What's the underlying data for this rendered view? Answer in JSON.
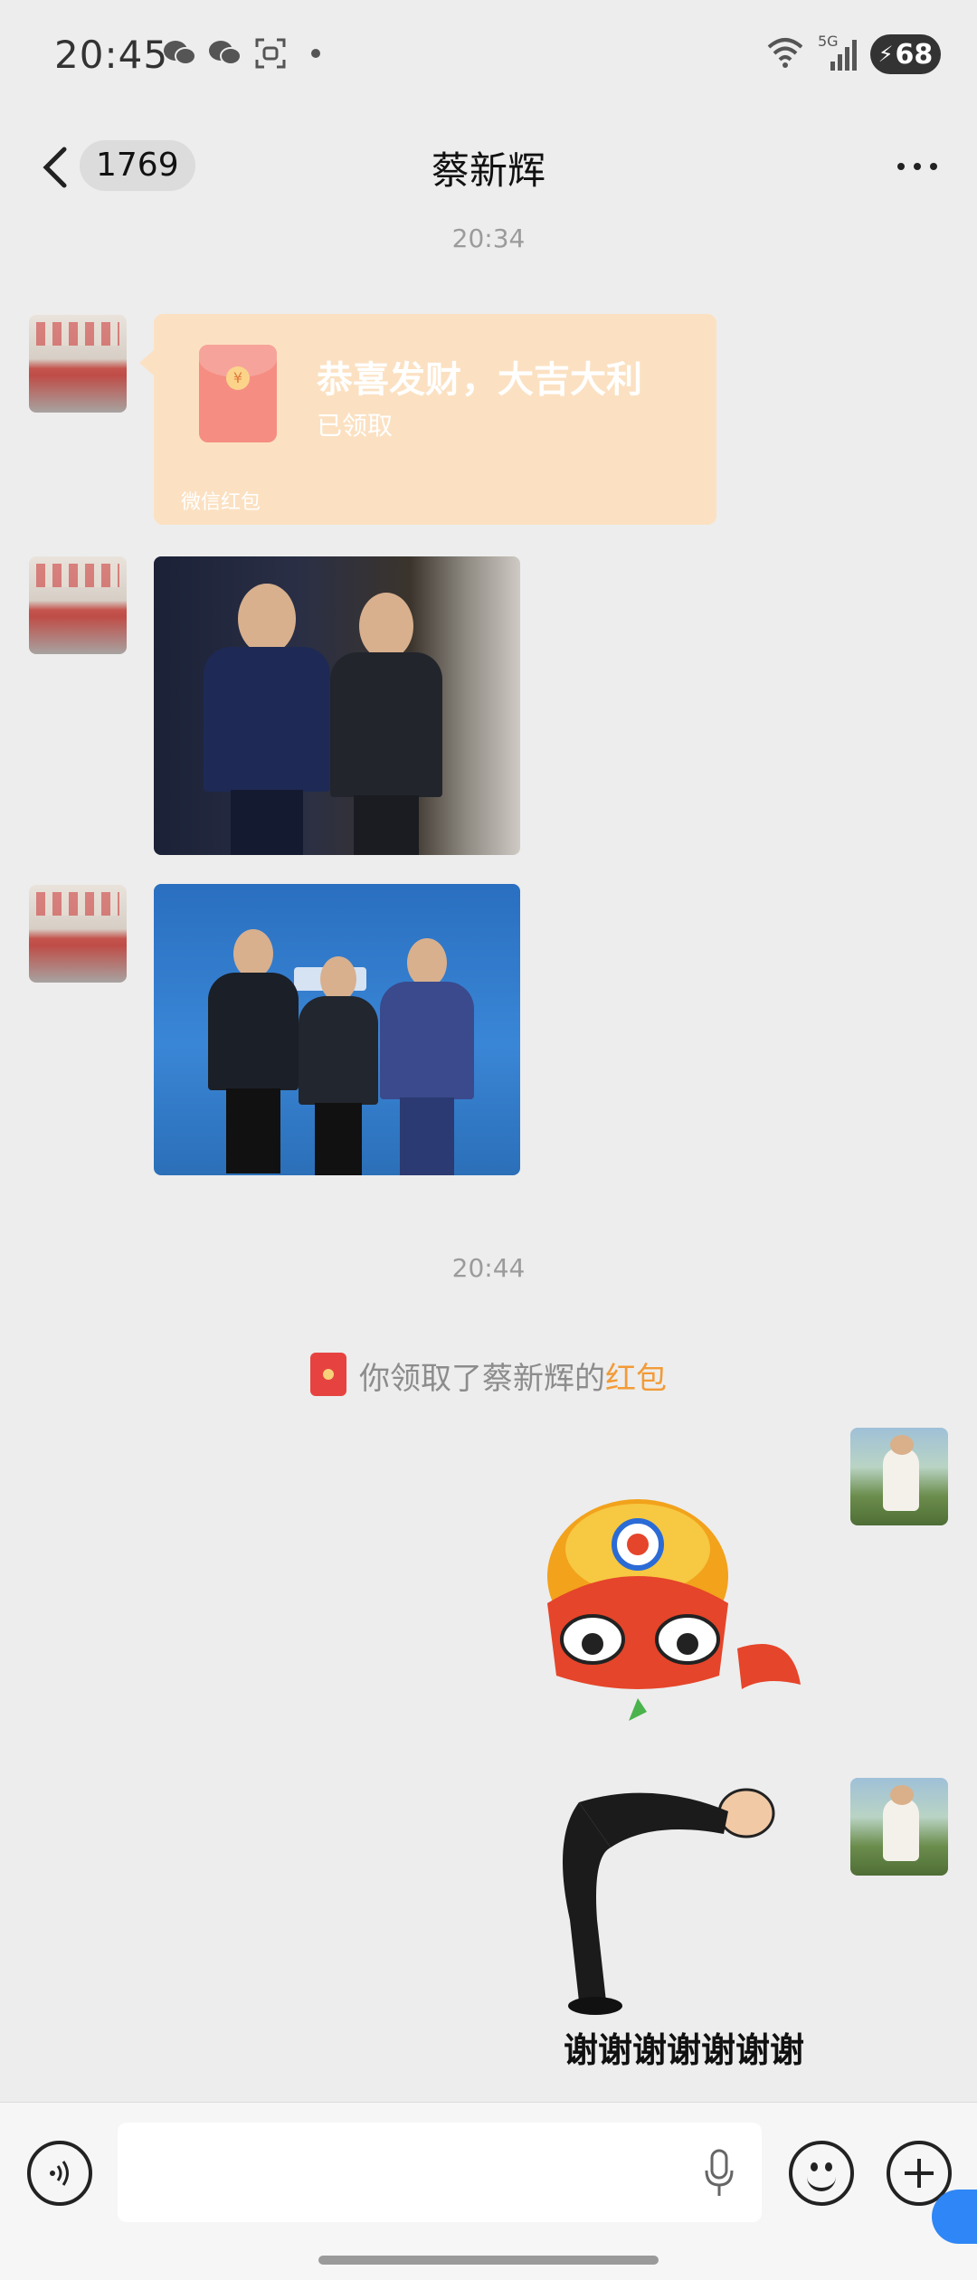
{
  "status_bar": {
    "time": "20:45",
    "left_icons": [
      "wechat-icon",
      "wechat-icon",
      "scan-icon",
      "dot-icon"
    ],
    "right_icons": [
      "wifi-icon",
      "signal-5g-icon"
    ],
    "signal_label": "5G",
    "battery": "68"
  },
  "header": {
    "back_label": "<",
    "unread_count": "1769",
    "title": "蔡新辉",
    "more_icon": "more-icon"
  },
  "messages": {
    "time1": "20:34",
    "red_packet": {
      "title": "恭喜发财，大吉大利",
      "status": "已领取",
      "footer": "微信红包",
      "coin": "¥"
    },
    "time2": "20:44",
    "system": {
      "prefix": "你领取了蔡新辉的",
      "link": "红包"
    },
    "sticker_caption": "谢谢谢谢谢谢谢"
  },
  "input_bar": {
    "text_value": "",
    "icons": [
      "voice-icon",
      "mic-icon",
      "emoji-icon",
      "plus-icon"
    ]
  },
  "colors": {
    "background": "#ededed",
    "red_packet_bg": "#fbe1c2",
    "link": "#f29b37"
  }
}
